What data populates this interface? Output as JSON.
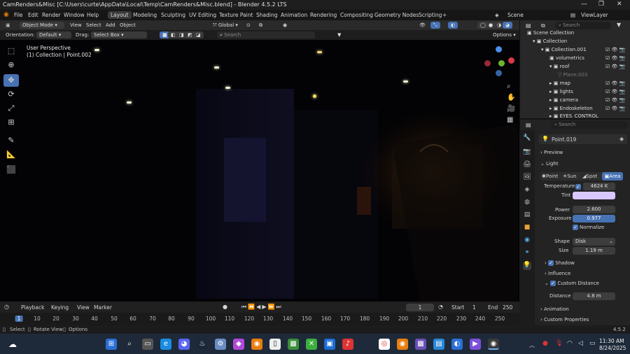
{
  "window": {
    "title": "CamRenders&Misc [C:\\Users\\curte\\AppData\\Local\\Temp\\CamRenders&Misc.blend] - Blender 4.5.2 LTS",
    "controls": [
      "—",
      "❐",
      "✕"
    ]
  },
  "menu": {
    "items": [
      "File",
      "Edit",
      "Render",
      "Window",
      "Help"
    ],
    "workspaces": [
      "Layout",
      "Modeling",
      "Sculpting",
      "UV Editing",
      "Texture Paint",
      "Shading",
      "Animation",
      "Rendering",
      "Compositing",
      "Geometry Nodes",
      "Scripting"
    ],
    "active_workspace": "Layout",
    "scene": "Scene",
    "view_layer": "ViewLayer"
  },
  "header": {
    "mode": "Object Mode",
    "menus": [
      "View",
      "Select",
      "Add",
      "Object"
    ],
    "transform": "Global",
    "orientation_label": "Orientation:",
    "orientation_value": "Default",
    "drag_label": "Drag:",
    "drag_value": "Select Box",
    "search_placeholder": "Search",
    "options": "Options"
  },
  "viewport": {
    "perspective": "User Perspective",
    "collection_info": "(1) Collection | Point.002"
  },
  "outliner": {
    "search_placeholder": "Search",
    "items": [
      {
        "label": "Scene Collection",
        "icon": "collection-icon"
      },
      {
        "label": "Collection",
        "icon": "collection-icon"
      },
      {
        "label": "Collection.001",
        "icon": "collection-icon"
      },
      {
        "label": "volumetrics",
        "icon": "collection-icon"
      },
      {
        "label": "roof",
        "icon": "collection-icon"
      },
      {
        "label": "Plane.003",
        "icon": "mesh-icon"
      },
      {
        "label": "map",
        "icon": "collection-icon"
      },
      {
        "label": "lights",
        "icon": "collection-icon"
      },
      {
        "label": "camera",
        "icon": "collection-icon"
      },
      {
        "label": "Endoskeleton",
        "icon": "collection-icon"
      },
      {
        "label": "EYES_CONTROL",
        "icon": "collection-icon"
      }
    ]
  },
  "properties": {
    "search_placeholder": "Search",
    "object_name": "Point.019",
    "sections": {
      "preview": "Preview",
      "light": "Light",
      "shadow": "Shadow",
      "influence": "Influence",
      "custom_distance": "Custom Distance",
      "animation": "Animation",
      "custom_properties": "Custom Properties"
    },
    "light_types": [
      "Point",
      "Sun",
      "Spot",
      "Area"
    ],
    "active_light_type": "Area",
    "temperature_label": "Temperature",
    "temperature_value": "4624 K",
    "tint_label": "Tint",
    "tint_color": "#d8c8ff",
    "power_label": "Power",
    "power_value": "2.600",
    "exposure_label": "Exposure",
    "exposure_value": "0.977",
    "normalize_label": "Normalize",
    "shape_label": "Shape",
    "shape_value": "Disk",
    "size_label": "Size",
    "size_value": "1.19 m",
    "distance_label": "Distance",
    "distance_value": "4.8 m"
  },
  "timeline": {
    "menus": [
      "Playback",
      "Keying",
      "View",
      "Marker"
    ],
    "current_frame": "1",
    "start_label": "Start",
    "start_value": "1",
    "end_label": "End",
    "end_value": "250",
    "ruler": [
      "1",
      "10",
      "20",
      "30",
      "40",
      "50",
      "60",
      "70",
      "80",
      "90",
      "100",
      "110",
      "120",
      "130",
      "140",
      "150",
      "160",
      "170",
      "180",
      "190",
      "200",
      "210",
      "220",
      "230",
      "240",
      "250"
    ]
  },
  "status": {
    "select": "Select",
    "rotate": "Rotate View",
    "options": "Options",
    "version": "4.5.2"
  },
  "taskbar": {
    "time": "11:30 AM",
    "date": "8/24/2025"
  },
  "colors": {
    "accent": "#4772b3",
    "exposure_field": "#4772b3",
    "selected_tool": "#4772b3"
  }
}
